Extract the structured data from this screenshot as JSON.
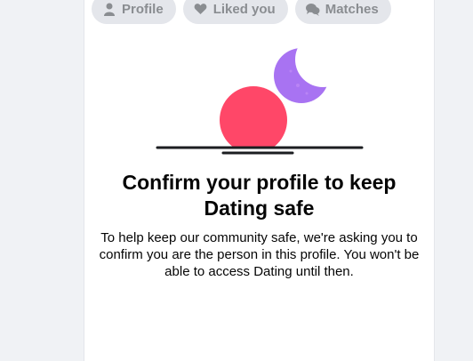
{
  "tabs": [
    {
      "label": "Profile",
      "icon": "person-icon"
    },
    {
      "label": "Liked you",
      "icon": "heart-icon"
    },
    {
      "label": "Matches",
      "icon": "chat-bubbles-icon"
    }
  ],
  "content": {
    "title": "Confirm your profile to keep Dating safe",
    "description": "To help keep our community safe, we're asking you to confirm you are the person in this profile. You won't be able to access Dating until then."
  },
  "colors": {
    "sun": "#ff4768",
    "moon": "#a873f2",
    "tab_bg": "#e4e6eb",
    "tab_text": "#8a8d91"
  }
}
